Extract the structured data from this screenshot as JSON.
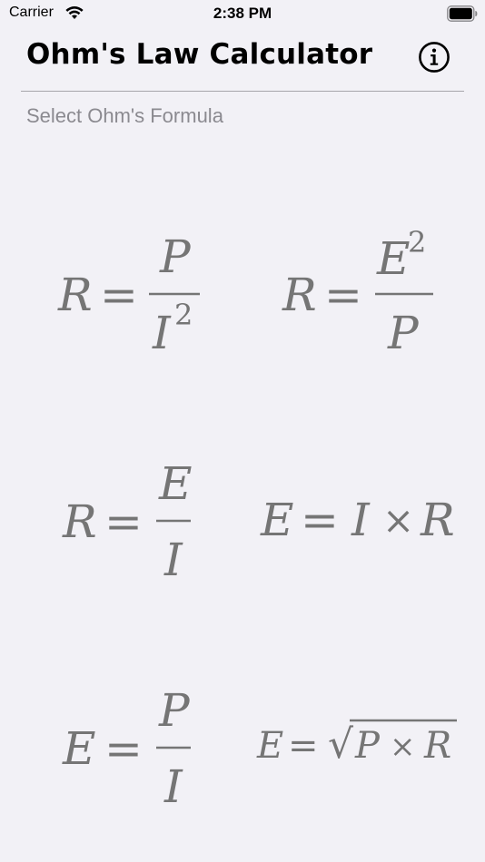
{
  "status_bar": {
    "carrier": "Carrier",
    "time": "2:38 PM"
  },
  "header": {
    "title": "Ohm's Law Calculator",
    "info_icon": "info-circle-icon"
  },
  "subtitle": "Select Ohm's Formula",
  "colors": {
    "background": "#f2f1f6",
    "formula_gray": "#757575",
    "subtitle_gray": "#8b8a90"
  },
  "formulas": [
    {
      "lhs": "R",
      "eq": "=",
      "num": "P",
      "den": "I",
      "den_sup": "2"
    },
    {
      "lhs": "R",
      "eq": "=",
      "num": "E",
      "num_sup": "2",
      "den": "P"
    },
    {
      "lhs": "R",
      "eq": "=",
      "num": "E",
      "den": "I"
    },
    {
      "lhs": "E",
      "eq": "=",
      "a": "I",
      "times": "×",
      "b": "R"
    },
    {
      "lhs": "E",
      "eq": "=",
      "num": "P",
      "den": "I"
    },
    {
      "lhs": "E",
      "eq": "=",
      "sqrt": "√",
      "a": "P",
      "times": "×",
      "b": "R"
    }
  ]
}
